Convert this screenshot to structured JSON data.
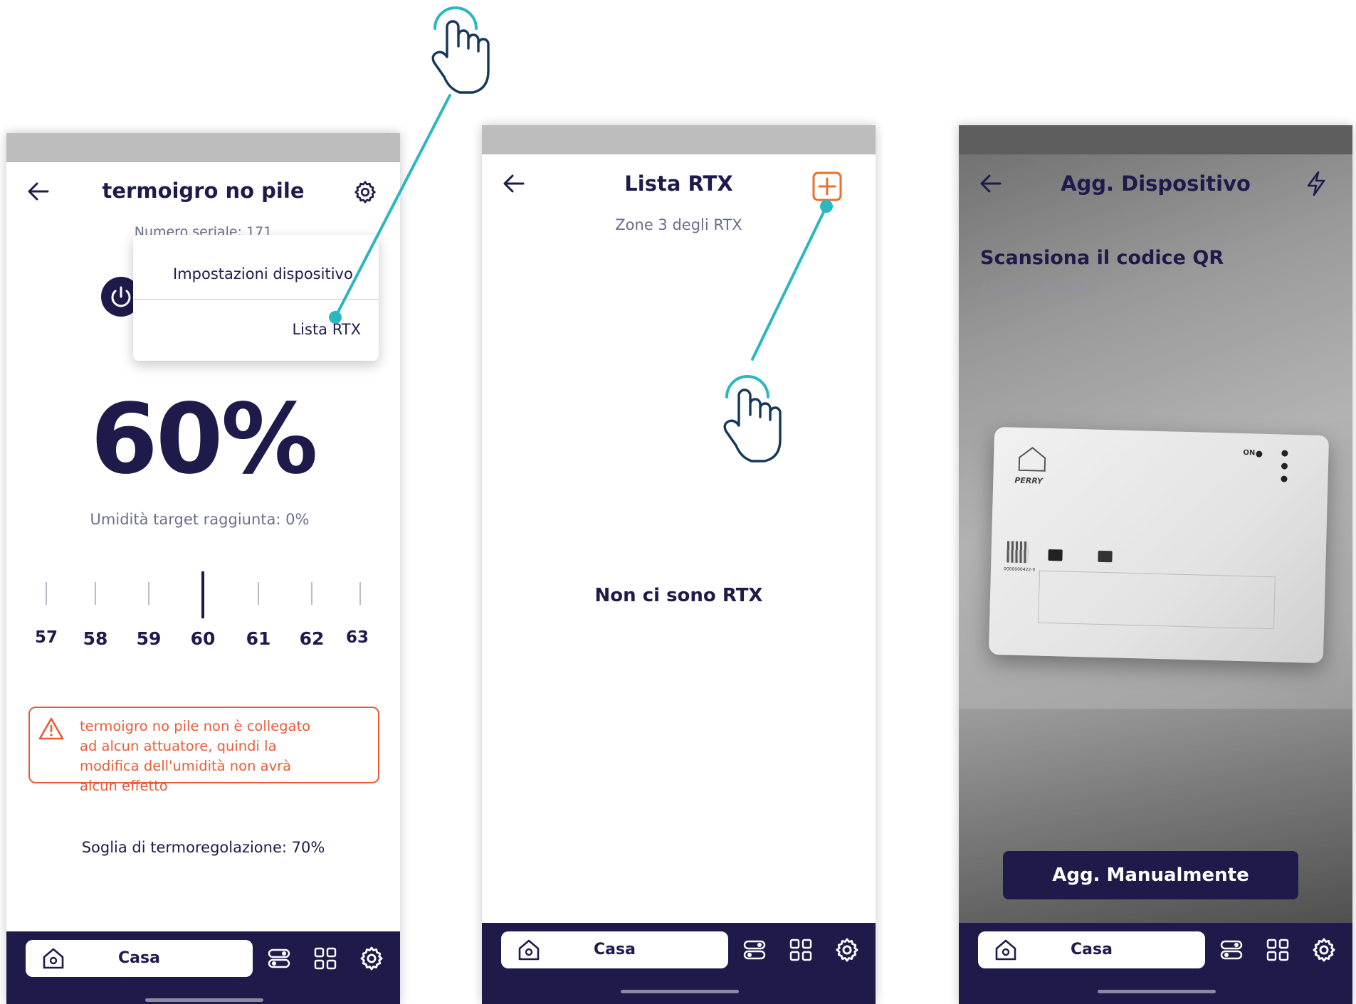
{
  "screen1": {
    "title": "termoigro no pile",
    "serial": "Numero seriale: 171",
    "menu": {
      "item1": "Impostazioni dispositivo",
      "item2": "Lista RTX"
    },
    "humidity_value": "60%",
    "target_text": "Umidità target raggiunta:  0%",
    "ruler": {
      "values": [
        "57",
        "58",
        "59",
        "60",
        "61",
        "62",
        "63"
      ],
      "selected": "60"
    },
    "warning": "termoigro no pile non è collegato ad alcun attuatore, quindi la modifica dell'umidità non avrà alcun effetto",
    "threshold": "Soglia di termoregolazione: 70%",
    "nav_home": "Casa"
  },
  "screen2": {
    "title": "Lista RTX",
    "subtitle": "Zone 3 degli RTX",
    "empty_text": "Non ci sono RTX",
    "nav_home": "Casa"
  },
  "screen3": {
    "title": "Agg. Dispositivo",
    "scan_title": "Scansiona il codice QR",
    "scan_subtitle": "Associa il dispositivo",
    "manual_button": "Agg. Manualmente",
    "device_brand": "PERRY",
    "device_on_label": "ON",
    "device_serial": "0000000422-0",
    "nav_home": "Casa"
  },
  "colors": {
    "navy": "#1e1b4b",
    "accent_teal": "#2bb7bf",
    "warning_orange": "#ea5b3a",
    "add_orange": "#e8702a",
    "statusbar_gray": "#bdbdbd"
  },
  "icons": [
    "back-arrow-icon",
    "gear-icon",
    "power-icon",
    "warning-triangle-icon",
    "plus-icon",
    "flash-icon",
    "home-icon",
    "toggles-icon",
    "grid-icon",
    "tap-hand-icon"
  ]
}
